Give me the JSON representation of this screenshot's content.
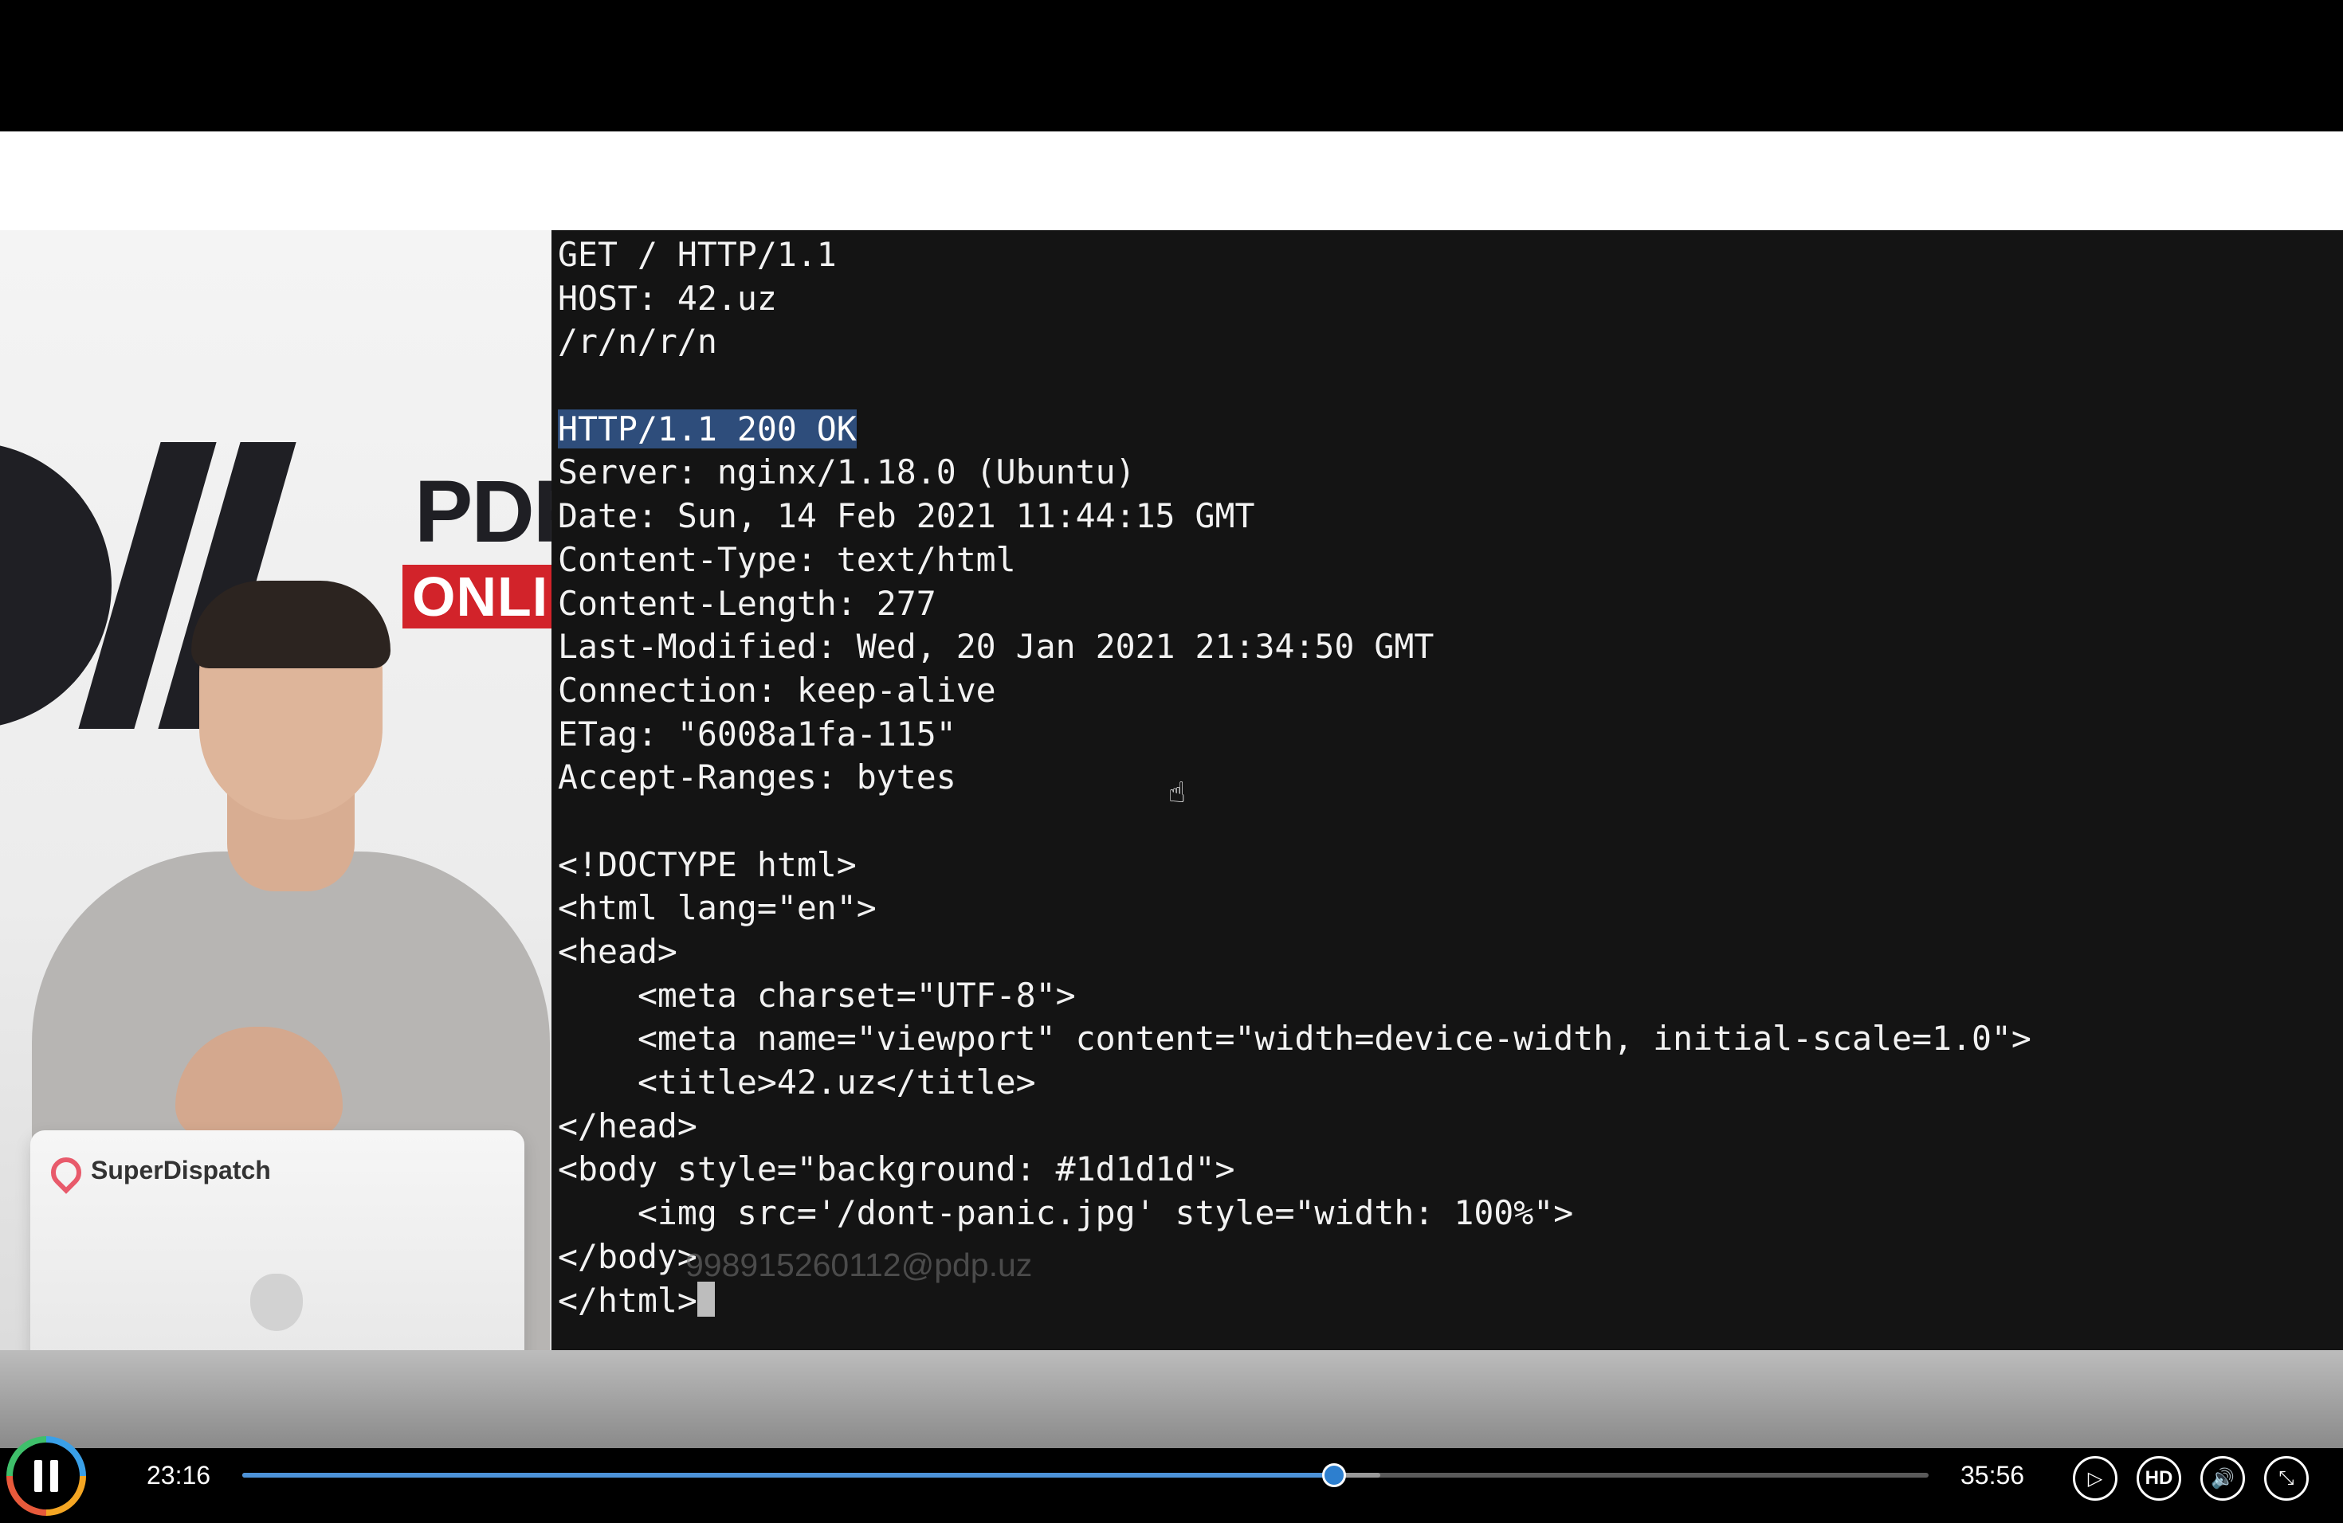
{
  "terminal": {
    "lines": [
      "GET / HTTP/1.1",
      "HOST: 42.uz",
      "/r/n/r/n",
      "",
      "HTTP/1.1 200 OK",
      "Server: nginx/1.18.0 (Ubuntu)",
      "Date: Sun, 14 Feb 2021 11:44:15 GMT",
      "Content-Type: text/html",
      "Content-Length: 277",
      "Last-Modified: Wed, 20 Jan 2021 21:34:50 GMT",
      "Connection: keep-alive",
      "ETag: \"6008a1fa-115\"",
      "Accept-Ranges: bytes",
      "",
      "<!DOCTYPE html>",
      "<html lang=\"en\">",
      "<head>",
      "    <meta charset=\"UTF-8\">",
      "    <meta name=\"viewport\" content=\"width=device-width, initial-scale=1.0\">",
      "    <title>42.uz</title>",
      "</head>",
      "<body style=\"background: #1d1d1d\">",
      "    <img src='/dont-panic.jpg' style=\"width: 100%\">",
      "</body>",
      "</html>"
    ],
    "highlighted_line_index": 4
  },
  "watermark": "998915260112@pdp.uz",
  "presenter": {
    "logo_pdp": "PDP",
    "logo_online": "ONLINE",
    "laptop_brand": "SuperDispatch"
  },
  "player": {
    "current_time": "23:16",
    "duration": "35:56",
    "progress_fraction": 0.6475,
    "buffered_fraction": 0.675,
    "hd_label": "HD",
    "colors": {
      "progress": "#4c92d8",
      "terminal_bg": "#141414",
      "highlight": "#2e4d7b"
    }
  }
}
